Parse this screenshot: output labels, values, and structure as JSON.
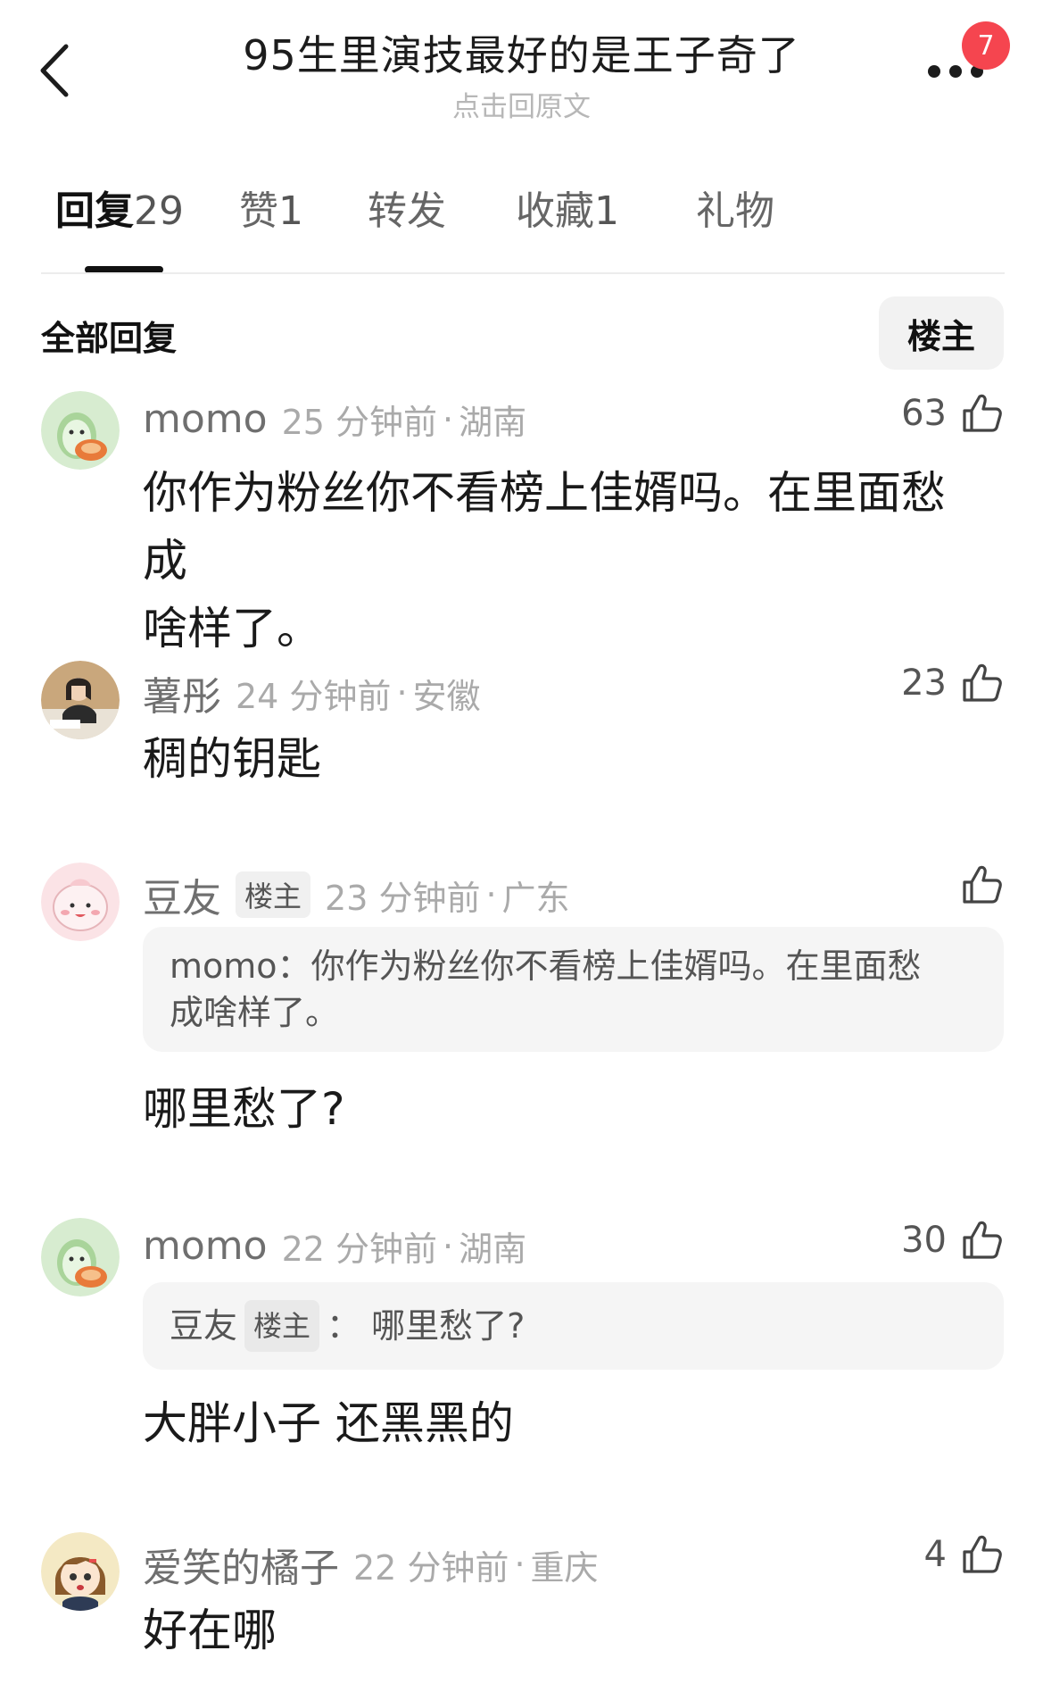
{
  "header": {
    "title": "95生里演技最好的是王子奇了",
    "subtitle": "点击回原文",
    "notification_count": "7"
  },
  "tabs": [
    {
      "label": "回复",
      "count": "29"
    },
    {
      "label": "赞",
      "count": "1"
    },
    {
      "label": "转发",
      "count": ""
    },
    {
      "label": "收藏",
      "count": "1"
    },
    {
      "label": "礼物",
      "count": ""
    }
  ],
  "section": {
    "title": "全部回复",
    "op_filter": "楼主"
  },
  "comments": [
    {
      "username": "momo",
      "time": "25 分钟前",
      "sep": "·",
      "region": "湖南",
      "likes": "63",
      "content_line1": "你作为粉丝你不看榜上佳婿吗。在里面愁成",
      "content_line2": "啥样了。",
      "avatar": "green-cartoon-avatar"
    },
    {
      "username": "薯彤",
      "time": "24 分钟前",
      "sep": "·",
      "region": "安徽",
      "likes": "23",
      "content": "稠的钥匙",
      "avatar": "photo-avatar"
    },
    {
      "username": "豆友",
      "op_tag": "楼主",
      "time": "23 分钟前",
      "sep": "·",
      "region": "广东",
      "likes": "",
      "quote_line1": "momo：你作为粉丝你不看榜上佳婿吗。在里面愁",
      "quote_line2": "成啥样了。",
      "content": "哪里愁了?",
      "avatar": "pink-cartoon-avatar"
    },
    {
      "username": "momo",
      "time": "22 分钟前",
      "sep": "·",
      "region": "湖南",
      "likes": "30",
      "quote_user": "豆友",
      "quote_op_tag": "楼主",
      "quote_text": "： 哪里愁了?",
      "content": "大胖小子 还黑黑的",
      "avatar": "green-cartoon-avatar"
    },
    {
      "username": "爱笑的橘子",
      "time": "22 分钟前",
      "sep": "·",
      "region": "重庆",
      "likes": "4",
      "content": "好在哪",
      "avatar": "anime-girl-avatar"
    }
  ],
  "colors": {
    "badge": "#f5454f",
    "text_primary": "#1a1a1a",
    "text_secondary": "#aaaaaa",
    "quote_bg": "#f5f5f5"
  }
}
